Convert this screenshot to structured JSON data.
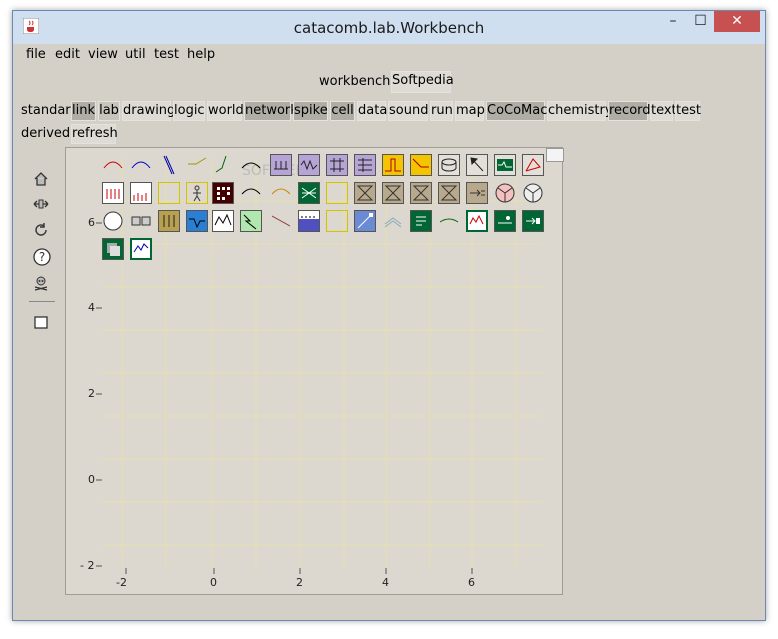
{
  "window": {
    "title": "catacomb.lab.Workbench",
    "minimize": "–",
    "maximize": "☐",
    "close": "✕"
  },
  "menu": [
    "file",
    "edit",
    "view",
    "util",
    "test",
    "help"
  ],
  "header": {
    "workbench_label": "workbench",
    "tab_label": "Softpedia"
  },
  "palette_row1": {
    "label": "standard",
    "items": [
      "link",
      "lab",
      "drawing",
      "logic",
      "world",
      "network",
      "spike",
      "cell",
      "data",
      "sound",
      "run",
      "map",
      "CoCoMac",
      "chemistry",
      "record",
      "text",
      "test"
    ]
  },
  "palette_row2": {
    "label": "derived",
    "items": [
      "refresh"
    ]
  },
  "sidebar_tools": [
    "home-icon",
    "fit-icon",
    "rotate-icon",
    "help-icon",
    "skull-icon",
    "square-icon"
  ],
  "plot": {
    "y_ticks": [
      "6",
      "4",
      "2",
      "0",
      "- 2"
    ],
    "x_ticks": [
      "-2",
      "0",
      "2",
      "4",
      "6"
    ],
    "watermark": "SOFTPEDIA"
  },
  "colors": {
    "title_bar": "#cfdff0",
    "panel_bg": "#d4d0c8",
    "close": "#c75050",
    "grid": "#e8e0a8"
  }
}
